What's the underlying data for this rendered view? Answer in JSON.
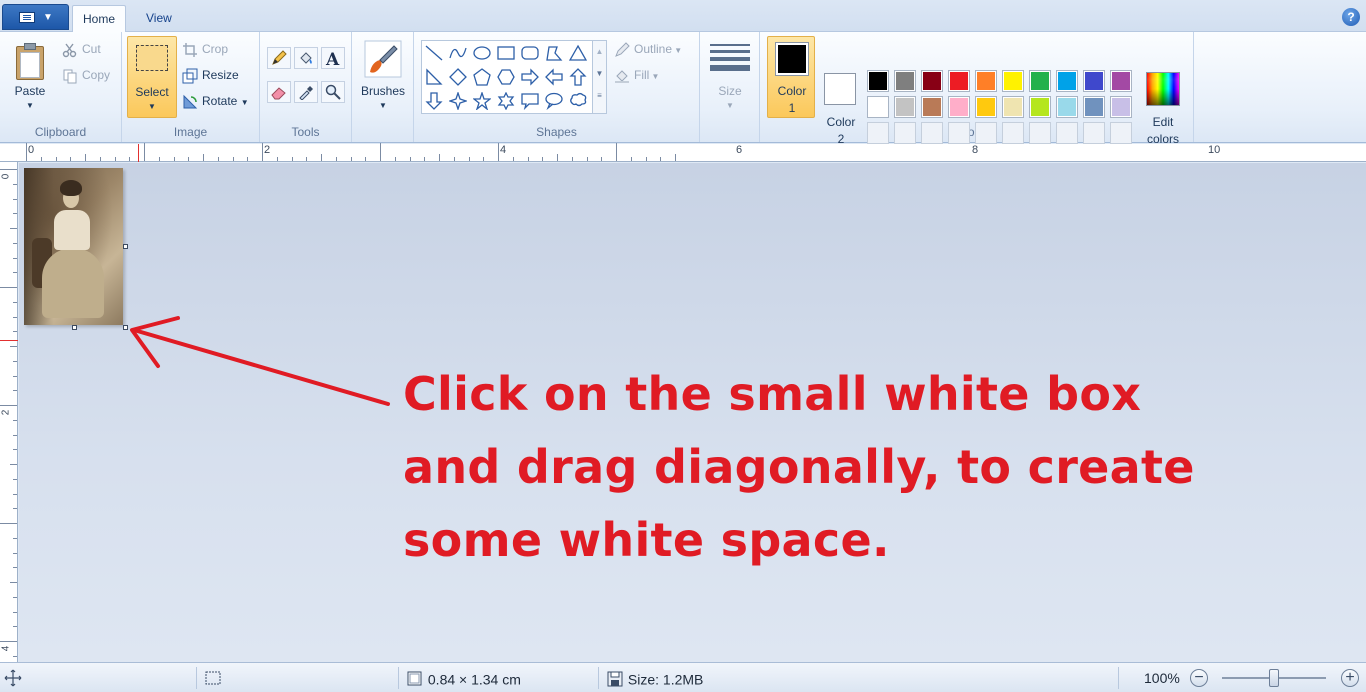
{
  "tabs": {
    "home": "Home",
    "view": "View"
  },
  "help": "?",
  "clipboard": {
    "paste": "Paste",
    "cut": "Cut",
    "copy": "Copy",
    "group": "Clipboard"
  },
  "image": {
    "select": "Select",
    "crop": "Crop",
    "resize": "Resize",
    "rotate": "Rotate",
    "group": "Image"
  },
  "tools": {
    "group": "Tools"
  },
  "brushes": {
    "label": "Brushes"
  },
  "shapes": {
    "outline": "Outline",
    "fill": "Fill",
    "group": "Shapes"
  },
  "size": {
    "label": "Size"
  },
  "colors": {
    "color1_label_a": "Color",
    "color1_label_b": "1",
    "color2_label_a": "Color",
    "color2_label_b": "2",
    "edit_label_a": "Edit",
    "edit_label_b": "colors",
    "group": "Colors",
    "color1": "#000000",
    "color2": "#ffffff",
    "palette_row1": [
      "#000000",
      "#7f7f7f",
      "#880015",
      "#ed1c24",
      "#ff7f27",
      "#fff200",
      "#22b14c",
      "#00a2e8",
      "#3f48cc",
      "#a349a4"
    ],
    "palette_row2": [
      "#ffffff",
      "#c3c3c3",
      "#b97a57",
      "#ffaec9",
      "#ffc90e",
      "#efe4b0",
      "#b5e61d",
      "#99d9ea",
      "#7092be",
      "#c8bfe7"
    ]
  },
  "ruler": {
    "h_labels": [
      "0",
      "2",
      "4",
      "6",
      "8",
      "10"
    ],
    "v_labels": [
      "0",
      "2",
      "4"
    ]
  },
  "instruction": {
    "line1": "Click on the small white box",
    "line2": "and drag diagonally, to create",
    "line3": "some white space."
  },
  "status": {
    "dimensions": "0.84 × 1.34 cm",
    "size": "Size: 1.2MB",
    "zoom": "100%"
  }
}
